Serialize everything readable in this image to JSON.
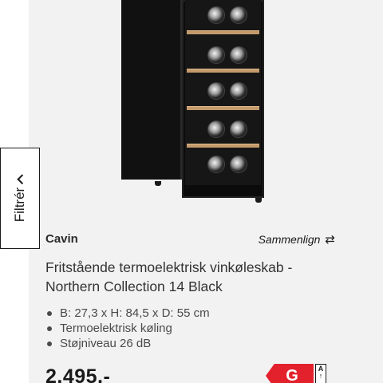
{
  "filter": {
    "label": "Filtrér"
  },
  "product": {
    "brand": "Cavin",
    "compare_label": "Sammenlign",
    "title": "Fritstående termoelektrisk vinkøleskab - Northern Collection 14 Black",
    "specs": [
      "B: 27,3 x H: 84,5 x D: 55 cm",
      "Termoelektrisk køling",
      "Støjniveau 26 dB"
    ],
    "price": "2.495,-",
    "energy_class": "G",
    "energy_scale": "A"
  },
  "colors": {
    "card_background": "#f2f2f2",
    "energy_label": "#e3212d",
    "shelf_wood": "#c49a6c"
  },
  "icons": {
    "compare": "swap-arrows-icon",
    "filter": "chevron-right-icon"
  }
}
